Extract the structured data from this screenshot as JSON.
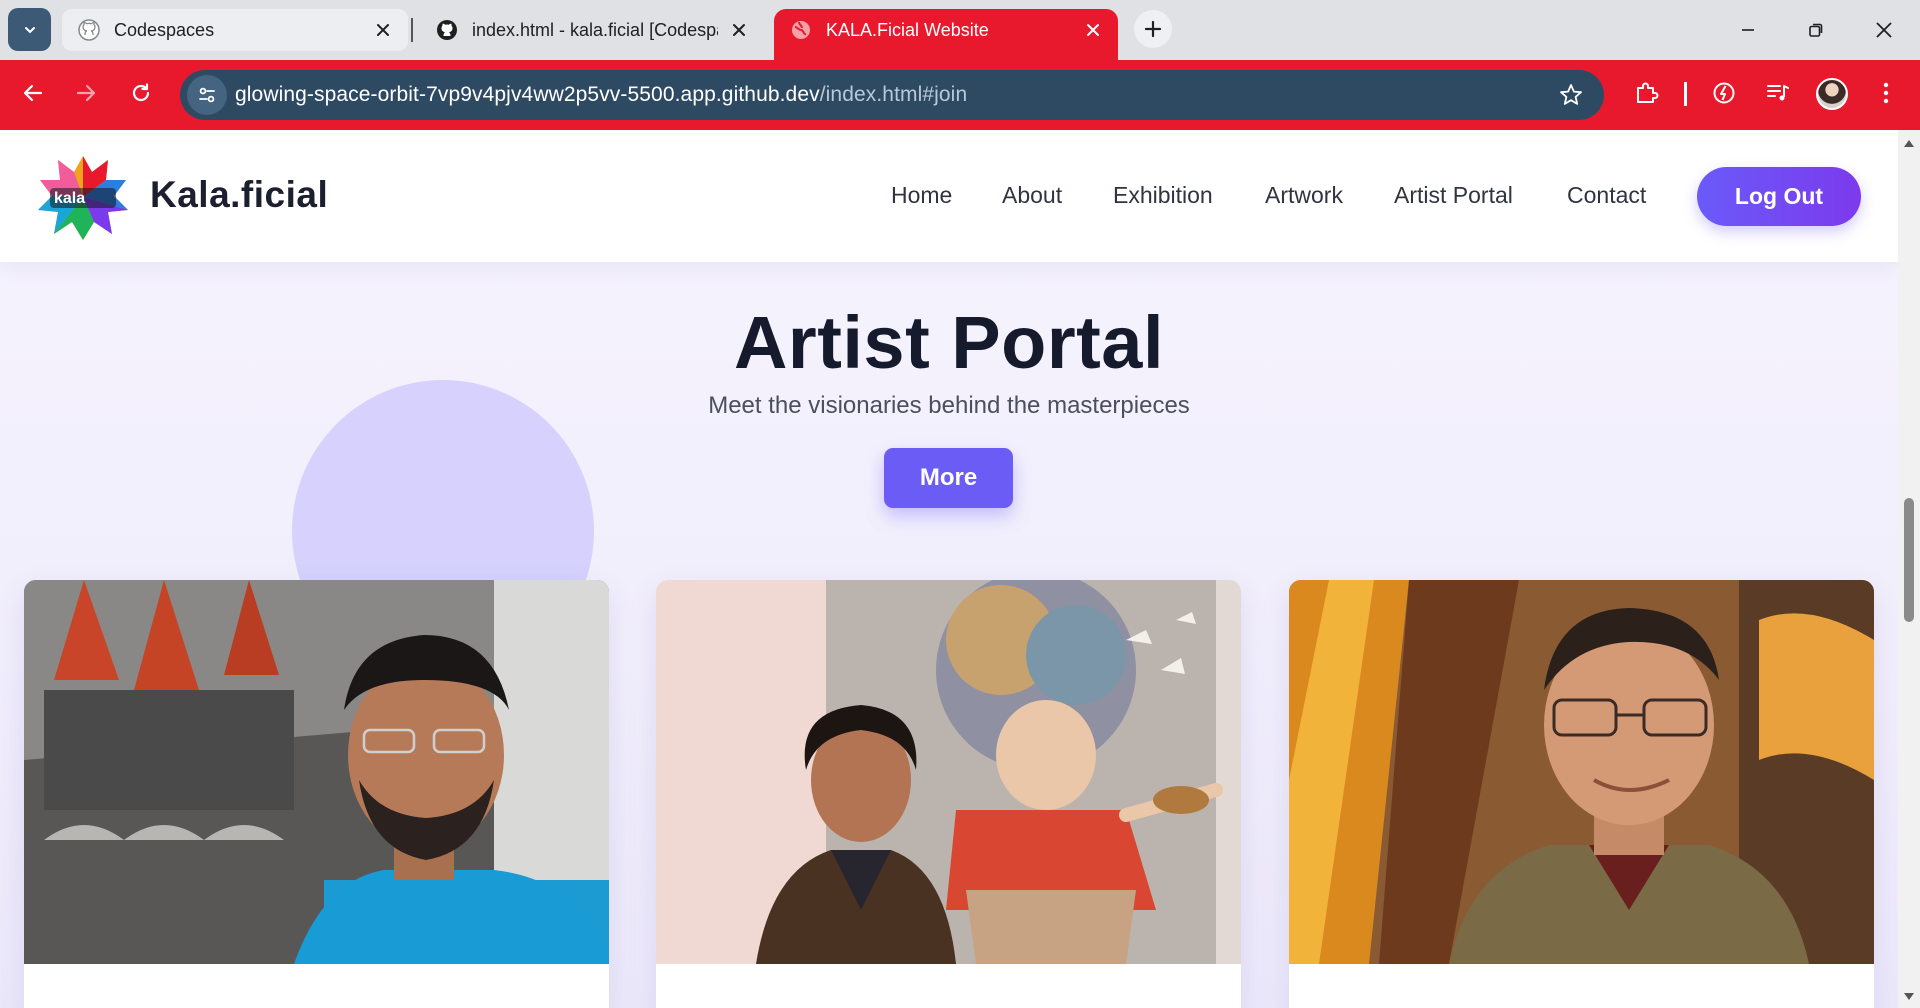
{
  "browser": {
    "tabs": [
      {
        "title": "Codespaces",
        "icon": "github-icon",
        "active": false
      },
      {
        "title": "index.html - kala.ficial [Codespa",
        "icon": "github-icon",
        "active": false
      },
      {
        "title": "KALA.Ficial Website",
        "icon": "globe-icon",
        "active": true
      }
    ],
    "address": {
      "host": "glowing-space-orbit-7vp9v4pjv4ww2p5vv-5500.app.github.dev",
      "path": "/index.html#join"
    },
    "colors": {
      "theme": "#e8192c",
      "omnibox": "#2e4a63",
      "tabstrip": "#dfe1e5"
    }
  },
  "site": {
    "brand": "Kala.ficial",
    "logo_text": "kala",
    "nav": [
      "Home",
      "About",
      "Exhibition",
      "Artwork",
      "Artist Portal",
      "Contact"
    ],
    "logout_label": "Log Out",
    "accent_color": "#6b5cf6"
  },
  "section": {
    "title": "Artist Portal",
    "subtitle": "Meet the visionaries behind the masterpieces",
    "more_label": "More"
  },
  "artists": [
    {
      "photo": "artist-portrait-1"
    },
    {
      "photo": "artist-portrait-2"
    },
    {
      "photo": "artist-portrait-3"
    }
  ]
}
